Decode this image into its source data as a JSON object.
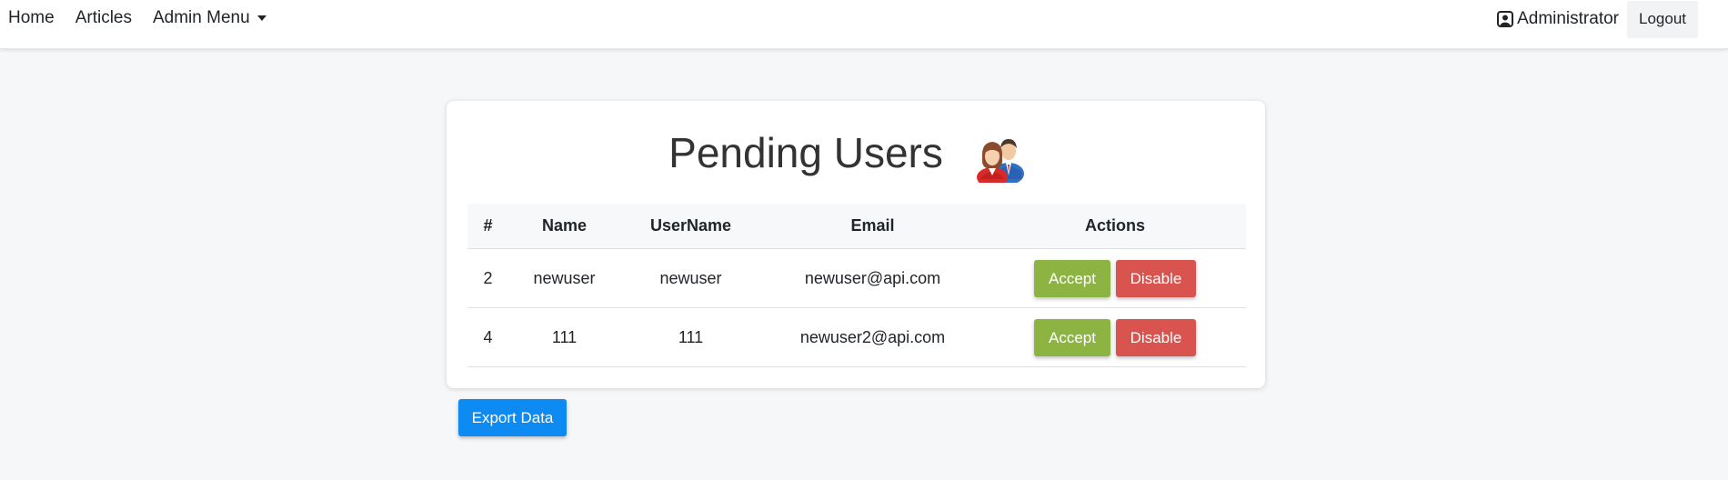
{
  "nav": {
    "home": "Home",
    "articles": "Articles",
    "admin_menu": "Admin Menu",
    "user": "Administrator",
    "logout": "Logout"
  },
  "page": {
    "title": "Pending Users",
    "icon": "users-icon"
  },
  "table": {
    "headers": {
      "num": "#",
      "name": "Name",
      "username": "UserName",
      "email": "Email",
      "actions": "Actions"
    },
    "rows": [
      {
        "num": "2",
        "name": "newuser",
        "username": "newuser",
        "email": "newuser@api.com",
        "accept": "Accept",
        "disable": "Disable"
      },
      {
        "num": "4",
        "name": "111",
        "username": "111",
        "email": "newuser2@api.com",
        "accept": "Accept",
        "disable": "Disable"
      }
    ]
  },
  "export_label": "Export Data",
  "colors": {
    "accept": "#8db443",
    "disable": "#d9534f",
    "export": "#0d8bf2",
    "background": "#f6f7f9"
  }
}
